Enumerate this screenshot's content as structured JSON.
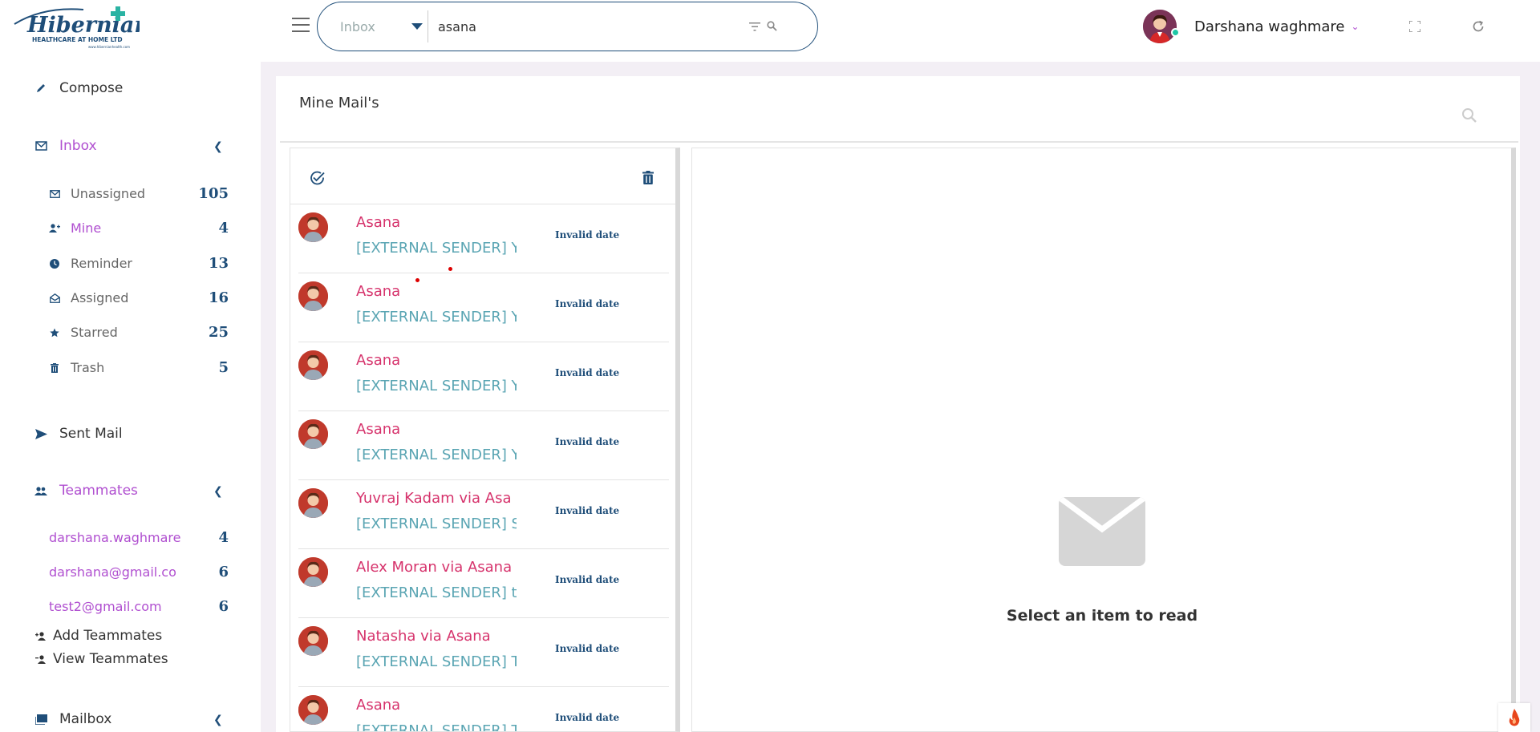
{
  "brand": {
    "logo_text": "Hibernian",
    "logo_subtext": "HEALTHCARE AT HOME LTD",
    "logo_color": "#1f4e79",
    "logo_cross_color": "#2ab3a3"
  },
  "sidebar": {
    "compose": "Compose",
    "inbox": "Inbox",
    "inbox_items": [
      {
        "label": "Unassigned",
        "count": "105",
        "icon": "envelope-icon"
      },
      {
        "label": "Mine",
        "count": "4",
        "icon": "user-plus-icon"
      },
      {
        "label": "Reminder",
        "count": "13",
        "icon": "clock-icon"
      },
      {
        "label": "Assigned",
        "count": "16",
        "icon": "envelope-open-icon"
      },
      {
        "label": "Starred",
        "count": "25",
        "icon": "star-icon"
      },
      {
        "label": "Trash",
        "count": "5",
        "icon": "trash-icon"
      }
    ],
    "sent_mail": "Sent Mail",
    "teammates": "Teammates",
    "teammate_items": [
      {
        "label": "darshana.waghmare",
        "count": "4"
      },
      {
        "label": "darshana@gmail.co",
        "count": "6"
      },
      {
        "label": "test2@gmail.com",
        "count": "6"
      }
    ],
    "add_teammates": "Add Teammates",
    "view_teammates": "View Teammates",
    "mailbox": "Mailbox"
  },
  "header": {
    "folder_select": "Inbox",
    "search_value": "asana",
    "user_name": "Darshana waghmare"
  },
  "main": {
    "title": "Mine Mail's",
    "empty_state": "Select an item to read",
    "mails": [
      {
        "sender": "Asana",
        "subject": "[EXTERNAL SENDER] Yo",
        "date": "Invalid date"
      },
      {
        "sender": "Asana",
        "subject": "[EXTERNAL SENDER] Yo",
        "date": "Invalid date"
      },
      {
        "sender": "Asana",
        "subject": "[EXTERNAL SENDER] Yo",
        "date": "Invalid date"
      },
      {
        "sender": "Asana",
        "subject": "[EXTERNAL SENDER] Yo",
        "date": "Invalid date"
      },
      {
        "sender": "Yuvraj Kadam via Asa",
        "subject": "[EXTERNAL SENDER] Sh",
        "date": "Invalid date"
      },
      {
        "sender": "Alex Moran via Asana",
        "subject": "[EXTERNAL SENDER] te",
        "date": "Invalid date"
      },
      {
        "sender": "Natasha via Asana",
        "subject": "[EXTERNAL SENDER] Te",
        "date": "Invalid date"
      },
      {
        "sender": "Asana",
        "subject": "[EXTERNAL SENDER] Th",
        "date": "Invalid date"
      }
    ]
  },
  "colors": {
    "accent_purple": "#b04fd0",
    "navy": "#1f4e79",
    "sender_pink": "#d6336c",
    "subject_teal": "#5aa5b3",
    "main_bg": "#f3eff5"
  }
}
